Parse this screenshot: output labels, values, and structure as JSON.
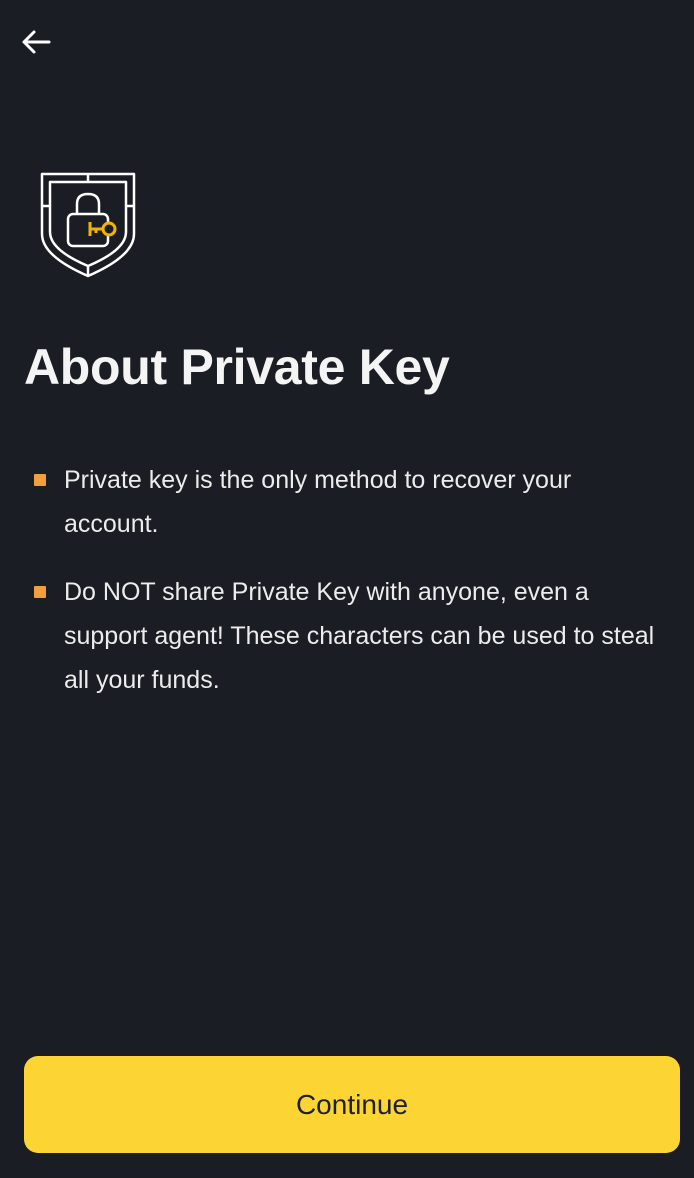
{
  "header": {
    "back_icon": "arrow-left-icon"
  },
  "hero": {
    "icon": "shield-lock-key-icon",
    "accent_color": "#f2b400"
  },
  "title": "About Private Key",
  "bullets": [
    "Private key is the only method to recover your account.",
    "Do NOT share Private Key with anyone, even a support agent! These characters can be used to steal all your funds."
  ],
  "colors": {
    "background": "#1b1d24",
    "bullet": "#f2a03d",
    "primary_button": "#fcd535"
  },
  "actions": {
    "continue_label": "Continue"
  }
}
